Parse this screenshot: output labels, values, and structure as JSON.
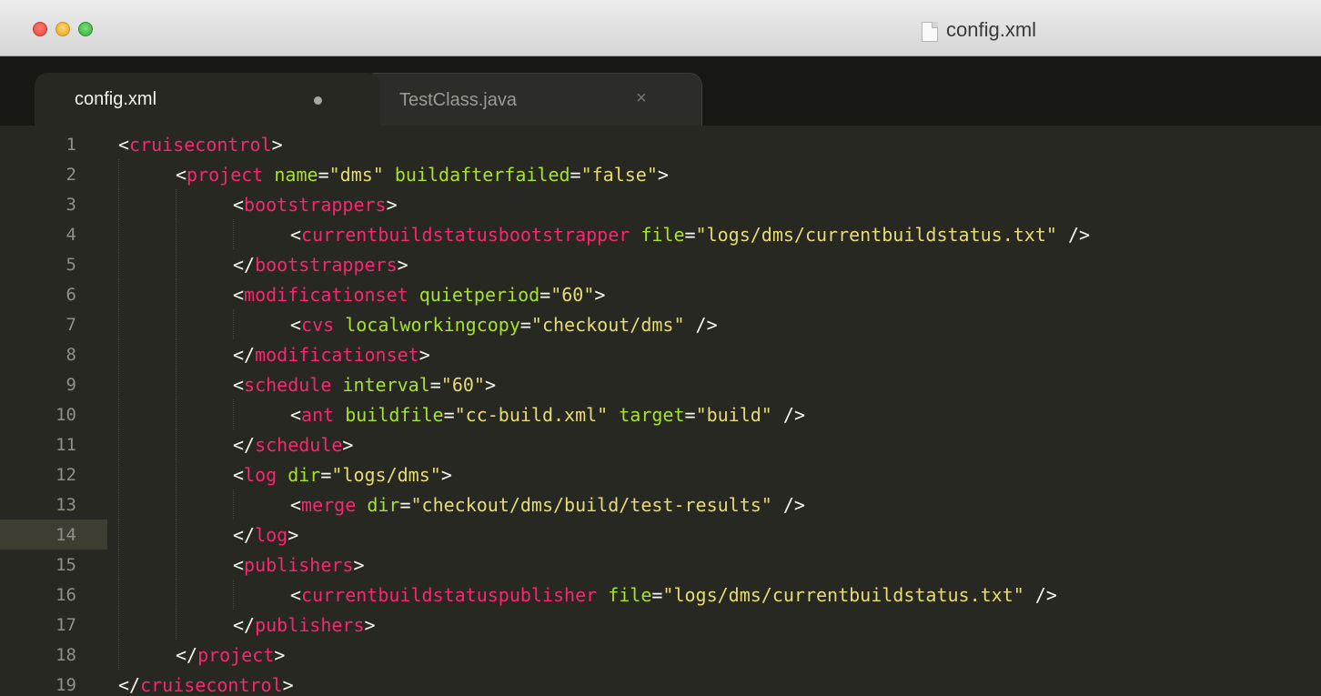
{
  "window": {
    "title": "config.xml"
  },
  "tabs": [
    {
      "label": "config.xml",
      "active": true,
      "modified": true
    },
    {
      "label": "TestClass.java",
      "active": false,
      "close_glyph": "×"
    }
  ],
  "editor": {
    "current_line": 14,
    "theme_colors": {
      "background": "#272822",
      "tag": "#f92672",
      "attribute": "#a6e22e",
      "string": "#e6db74",
      "text": "#f8f8f2",
      "line_number": "#8f908a"
    },
    "lines": [
      {
        "n": "1",
        "indent": 0,
        "parts": [
          [
            "p",
            "<"
          ],
          [
            "t",
            "cruisecontrol"
          ],
          [
            "p",
            ">"
          ]
        ]
      },
      {
        "n": "2",
        "indent": 1,
        "parts": [
          [
            "p",
            "<"
          ],
          [
            "t",
            "project"
          ],
          [
            "p",
            " "
          ],
          [
            "a",
            "name"
          ],
          [
            "p",
            "="
          ],
          [
            "s",
            "\"dms\""
          ],
          [
            "p",
            " "
          ],
          [
            "a",
            "buildafterfailed"
          ],
          [
            "p",
            "="
          ],
          [
            "s",
            "\"false\""
          ],
          [
            "p",
            ">"
          ]
        ]
      },
      {
        "n": "3",
        "indent": 2,
        "parts": [
          [
            "p",
            "<"
          ],
          [
            "t",
            "bootstrappers"
          ],
          [
            "p",
            ">"
          ]
        ]
      },
      {
        "n": "4",
        "indent": 3,
        "parts": [
          [
            "p",
            "<"
          ],
          [
            "t",
            "currentbuildstatusbootstrapper"
          ],
          [
            "p",
            " "
          ],
          [
            "a",
            "file"
          ],
          [
            "p",
            "="
          ],
          [
            "s",
            "\"logs/dms/currentbuildstatus.txt\""
          ],
          [
            "p",
            " />"
          ]
        ]
      },
      {
        "n": "5",
        "indent": 2,
        "parts": [
          [
            "p",
            "</"
          ],
          [
            "t",
            "bootstrappers"
          ],
          [
            "p",
            ">"
          ]
        ]
      },
      {
        "n": "6",
        "indent": 2,
        "parts": [
          [
            "p",
            "<"
          ],
          [
            "t",
            "modificationset"
          ],
          [
            "p",
            " "
          ],
          [
            "a",
            "quietperiod"
          ],
          [
            "p",
            "="
          ],
          [
            "s",
            "\"60\""
          ],
          [
            "p",
            ">"
          ]
        ]
      },
      {
        "n": "7",
        "indent": 3,
        "parts": [
          [
            "p",
            "<"
          ],
          [
            "t",
            "cvs"
          ],
          [
            "p",
            " "
          ],
          [
            "a",
            "localworkingcopy"
          ],
          [
            "p",
            "="
          ],
          [
            "s",
            "\"checkout/dms\""
          ],
          [
            "p",
            " />"
          ]
        ]
      },
      {
        "n": "8",
        "indent": 2,
        "parts": [
          [
            "p",
            "</"
          ],
          [
            "t",
            "modificationset"
          ],
          [
            "p",
            ">"
          ]
        ]
      },
      {
        "n": "9",
        "indent": 2,
        "parts": [
          [
            "p",
            "<"
          ],
          [
            "t",
            "schedule"
          ],
          [
            "p",
            " "
          ],
          [
            "a",
            "interval"
          ],
          [
            "p",
            "="
          ],
          [
            "s",
            "\"60\""
          ],
          [
            "p",
            ">"
          ]
        ]
      },
      {
        "n": "10",
        "indent": 3,
        "parts": [
          [
            "p",
            "<"
          ],
          [
            "t",
            "ant"
          ],
          [
            "p",
            " "
          ],
          [
            "a",
            "buildfile"
          ],
          [
            "p",
            "="
          ],
          [
            "s",
            "\"cc-build.xml\""
          ],
          [
            "p",
            " "
          ],
          [
            "a",
            "target"
          ],
          [
            "p",
            "="
          ],
          [
            "s",
            "\"build\""
          ],
          [
            "p",
            " />"
          ]
        ]
      },
      {
        "n": "11",
        "indent": 2,
        "parts": [
          [
            "p",
            "</"
          ],
          [
            "t",
            "schedule"
          ],
          [
            "p",
            ">"
          ]
        ]
      },
      {
        "n": "12",
        "indent": 2,
        "parts": [
          [
            "p",
            "<"
          ],
          [
            "t",
            "log"
          ],
          [
            "p",
            " "
          ],
          [
            "a",
            "dir"
          ],
          [
            "p",
            "="
          ],
          [
            "s",
            "\"logs/dms\""
          ],
          [
            "p",
            ">"
          ]
        ]
      },
      {
        "n": "13",
        "indent": 3,
        "parts": [
          [
            "p",
            "<"
          ],
          [
            "t",
            "merge"
          ],
          [
            "p",
            " "
          ],
          [
            "a",
            "dir"
          ],
          [
            "p",
            "="
          ],
          [
            "s",
            "\"checkout/dms/build/test-results\""
          ],
          [
            "p",
            " />"
          ]
        ]
      },
      {
        "n": "14",
        "indent": 2,
        "parts": [
          [
            "p",
            "</"
          ],
          [
            "t",
            "log"
          ],
          [
            "p",
            ">"
          ]
        ]
      },
      {
        "n": "15",
        "indent": 2,
        "parts": [
          [
            "p",
            "<"
          ],
          [
            "t",
            "publishers"
          ],
          [
            "p",
            ">"
          ]
        ]
      },
      {
        "n": "16",
        "indent": 3,
        "parts": [
          [
            "p",
            "<"
          ],
          [
            "t",
            "currentbuildstatuspublisher"
          ],
          [
            "p",
            " "
          ],
          [
            "a",
            "file"
          ],
          [
            "p",
            "="
          ],
          [
            "s",
            "\"logs/dms/currentbuildstatus.txt\""
          ],
          [
            "p",
            " />"
          ]
        ]
      },
      {
        "n": "17",
        "indent": 2,
        "parts": [
          [
            "p",
            "</"
          ],
          [
            "t",
            "publishers"
          ],
          [
            "p",
            ">"
          ]
        ]
      },
      {
        "n": "18",
        "indent": 1,
        "parts": [
          [
            "p",
            "</"
          ],
          [
            "t",
            "project"
          ],
          [
            "p",
            ">"
          ]
        ]
      },
      {
        "n": "19",
        "indent": 0,
        "parts": [
          [
            "p",
            "</"
          ],
          [
            "t",
            "cruisecontrol"
          ],
          [
            "p",
            ">"
          ]
        ]
      }
    ]
  }
}
